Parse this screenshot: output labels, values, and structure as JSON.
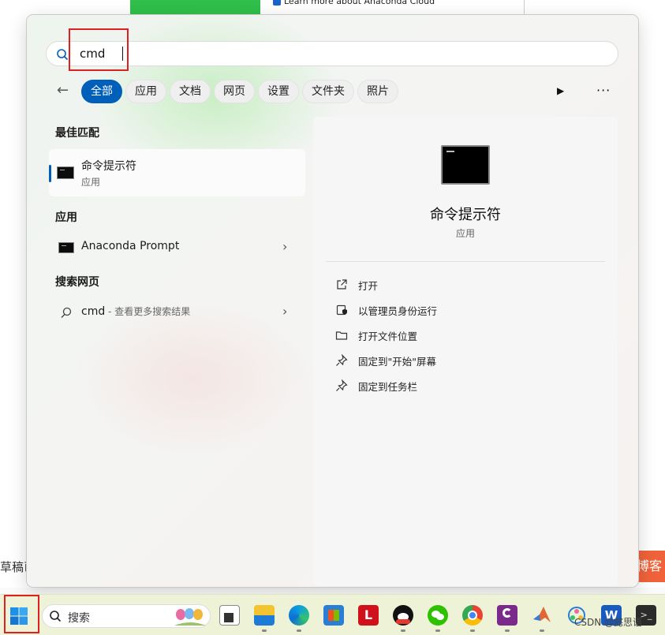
{
  "background": {
    "top_link_text": "Learn more about Anaconda Cloud",
    "left_edge_text": "草稿已",
    "right_edge_button": "博客"
  },
  "search": {
    "value": "cmd"
  },
  "filters": {
    "back_icon": "arrow-left-icon",
    "chips": [
      "全部",
      "应用",
      "文档",
      "网页",
      "设置",
      "文件夹",
      "照片"
    ],
    "active_index": 0,
    "play_icon": "play-icon",
    "more_icon": "more-icon"
  },
  "results": {
    "best_match_title": "最佳匹配",
    "best_match": {
      "name": "命令提示符",
      "type": "应用"
    },
    "apps_title": "应用",
    "apps": [
      {
        "name": "Anaconda Prompt"
      }
    ],
    "web_title": "搜索网页",
    "web": {
      "query": "cmd",
      "hint": " - 查看更多搜索结果"
    }
  },
  "detail": {
    "name": "命令提示符",
    "type": "应用",
    "actions": [
      {
        "label": "打开",
        "icon": "open-external-icon"
      },
      {
        "label": "以管理员身份运行",
        "icon": "shield-icon"
      },
      {
        "label": "打开文件位置",
        "icon": "folder-icon"
      },
      {
        "label": "固定到\"开始\"屏幕",
        "icon": "pin-icon"
      },
      {
        "label": "固定到任务栏",
        "icon": "pin-icon"
      }
    ]
  },
  "taskbar": {
    "search_placeholder": "搜索",
    "apps": [
      "task-view-icon",
      "file-explorer-icon",
      "edge-icon",
      "store-icon",
      "l-app-icon",
      "qq-icon",
      "wechat-icon",
      "chrome-icon",
      "pdf-icon",
      "matlab-icon",
      "network-icon",
      "word-icon",
      "terminal-icon"
    ],
    "watermark": "CSDN @懿思语"
  },
  "colors": {
    "accent": "#005fb8",
    "highlight_box": "#e02020",
    "taskbar": "#eef2d6"
  }
}
